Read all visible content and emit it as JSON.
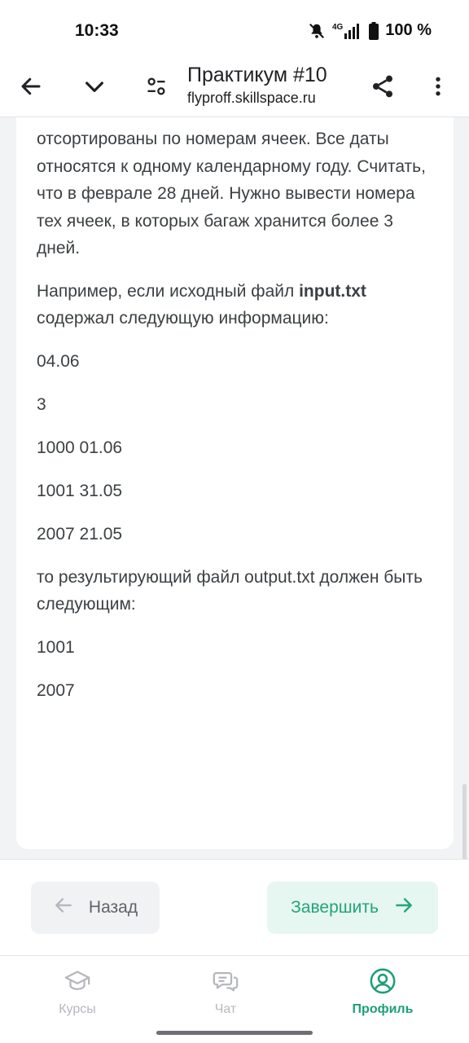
{
  "status_bar": {
    "time": "10:33",
    "network": "4G",
    "battery": "100 %"
  },
  "browser": {
    "title": "Практикум #10",
    "url": "flyproff.skillspace.ru",
    "icons": [
      "back-arrow-icon",
      "chevron-down-icon",
      "filter-settings-icon",
      "share-icon",
      "more-vert-icon"
    ]
  },
  "content": {
    "paragraph_1": "отсортированы по номерам ячеек. Все даты относятся к одному календарному году. Считать, что в феврале 28 дней. Нужно вывести номера тех ячеек, в которых багаж хранится более 3 дней.",
    "paragraph_2_prefix": "Например, если исходный файл ",
    "paragraph_2_bold": "input.txt",
    "paragraph_2_suffix": " содержал следующую информацию:",
    "input_lines": [
      "04.06",
      "3",
      "1000 01.06",
      "1001 31.05",
      "2007 21.05"
    ],
    "paragraph_3": "то результирующий файл output.txt должен быть следующим:",
    "output_lines": [
      "1001",
      "2007"
    ]
  },
  "actions": {
    "back_label": "Назад",
    "finish_label": "Завершить"
  },
  "bottom_nav": {
    "items": [
      {
        "label": "Курсы",
        "icon": "graduation-cap-icon",
        "active": false
      },
      {
        "label": "Чат",
        "icon": "chat-bubbles-icon",
        "active": false
      },
      {
        "label": "Профиль",
        "icon": "profile-circle-icon",
        "active": true
      }
    ]
  },
  "colors": {
    "accent": "#1e9e78",
    "finish_bg": "#e6f6f0",
    "inactive": "#b5b7bd"
  }
}
